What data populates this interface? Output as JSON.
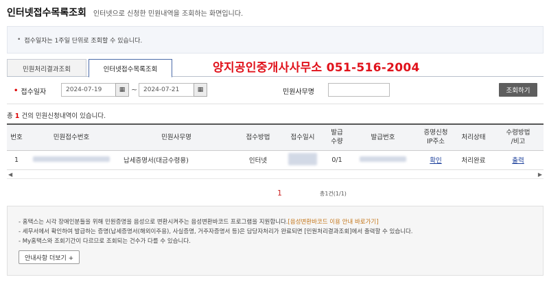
{
  "header": {
    "title": "인터넷접수목록조회",
    "description": "인터넷으로 신청한 민원내역을 조회하는 화면입니다."
  },
  "notice": {
    "text": "접수일자는 1주일 단위로 조회할 수 있습니다."
  },
  "tabs": [
    {
      "label": "민원처리결과조회",
      "active": false
    },
    {
      "label": "인터넷접수목록조회",
      "active": true
    }
  ],
  "overlay_text": "양지공인중개사사무소 051-516-2004",
  "search": {
    "date_label": "접수일자",
    "start_date": "2024-07-19",
    "end_date": "2024-07-21",
    "tilde": "~",
    "office_label": "민원사무명",
    "office_value": "",
    "button_label": "조회하기"
  },
  "result_count": {
    "prefix": "총",
    "count": "1",
    "suffix": "건의 민원신청내역이 있습니다."
  },
  "table": {
    "headers": {
      "no": "번호",
      "receipt_no": "민원접수번호",
      "office_name": "민원사무명",
      "method": "접수방법",
      "date": "접수일시",
      "qty_line1": "발급",
      "qty_line2": "수량",
      "issue_no": "발급번호",
      "ip_line1": "증명신청",
      "ip_line2": "IP주소",
      "status": "처리상태",
      "receive_line1": "수령방법",
      "receive_line2": "/비고"
    },
    "rows": [
      {
        "no": "1",
        "office_name": "납세증명서(대금수령용)",
        "method": "인터넷",
        "qty": "0/1",
        "ip_link": "확인",
        "status": "처리완료",
        "receive_link": "출력"
      }
    ]
  },
  "pager": {
    "current": "1",
    "total": "총1건(1/1)"
  },
  "info": {
    "line1": "- 홈택스는 시각 장애인분들을 위해 민원증명을 음성으로 변환시켜주는 음성변환바코드 프로그램을 지원합니다.",
    "line1_link": "[음성변환바코드 이용 안내 바로가기]",
    "line2": "- 세무서에서 확인하여 발급하는 증명(납세증명서(해외이주용), 사실증명, 거주자증명서 등)은 담당자처리가 완료되면 [민원처리결과조회]에서 출력할 수 있습니다.",
    "line3": "- My홈택스와 조회기간이 다르므로 조회되는 건수가 다를 수 있습니다.",
    "more_button": "안내사항 더보기 +"
  },
  "colors": {
    "accent_red": "#e0121b",
    "link_blue": "#1a3e9a",
    "button_gray": "#5e5e5e"
  }
}
